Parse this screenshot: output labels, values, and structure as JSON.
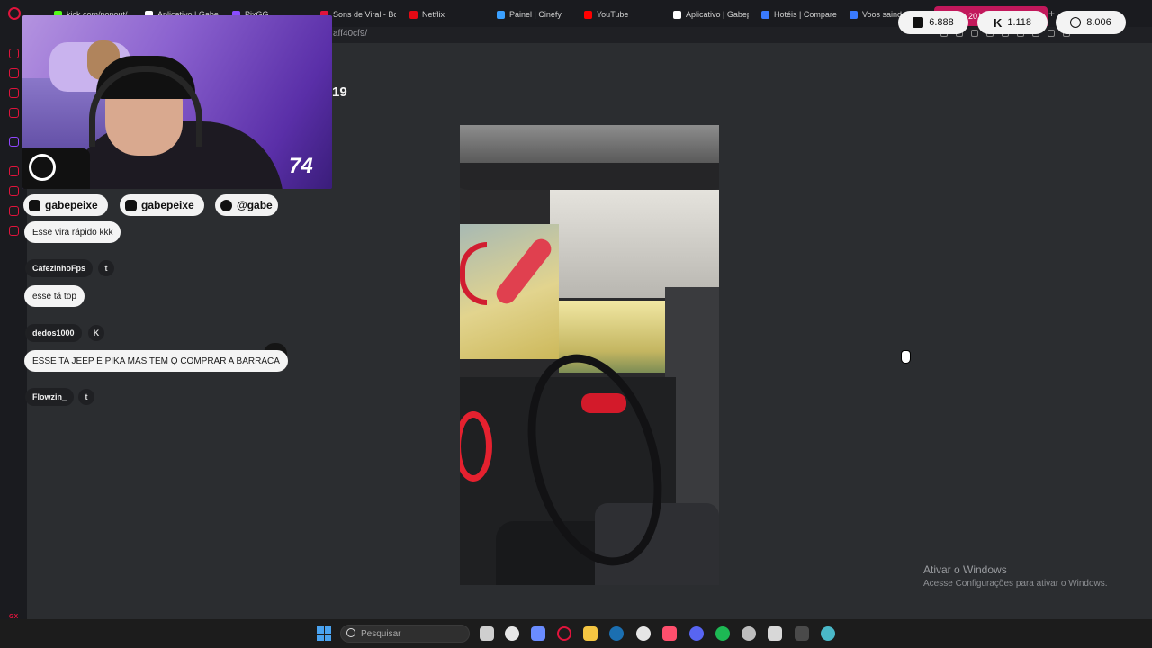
{
  "browser": {
    "tabs": [
      {
        "label": "kick.com/popout/",
        "color": "#53fc18"
      },
      {
        "label": "Aplicativo | Gabep",
        "color": "#ffffff"
      },
      {
        "label": "PixGG",
        "color": "#8a4dff"
      },
      {
        "label": "Sons de Viral - Bo",
        "color": "#e0143c"
      },
      {
        "label": "Netflix",
        "color": "#e50914"
      },
      {
        "label": "Painel | Cinefy",
        "color": "#3aa0ff"
      },
      {
        "label": "YouTube",
        "color": "#ff0000"
      },
      {
        "label": "Aplicativo | Gabep",
        "color": "#ffffff"
      },
      {
        "label": "Hotéis | Compare",
        "color": "#3a7bff"
      },
      {
        "label": "Voos saindo de",
        "color": "#3a7bff"
      }
    ],
    "active_tab": "Jeep 2019",
    "url": "aff40cf9/"
  },
  "page": {
    "heading": "19"
  },
  "webcam": {
    "overlay_number": "74"
  },
  "socials": [
    {
      "handle": "gabepeixe",
      "icon": "youtube-icon"
    },
    {
      "handle": "gabepeixe",
      "icon": "instagram-icon"
    },
    {
      "handle": "@gabe",
      "icon": "tiktok-icon"
    }
  ],
  "chat": {
    "first_message": "Esse vira rápido kkk",
    "entries": [
      {
        "user": "CafezinhoFps",
        "platform": "twitch",
        "badge": "t",
        "message": "esse tá top"
      },
      {
        "user": "dedos1000",
        "platform": "kick",
        "badge": "K",
        "message": "ESSE TA JEEP É PIKA MAS TEM Q COMPRAR A BARRACA"
      },
      {
        "user": "Flowzin_",
        "platform": "twitch",
        "badge": "t",
        "message": ""
      }
    ]
  },
  "viewers": {
    "twitch": "6.888",
    "kick": "1.118",
    "total": "8.006"
  },
  "watermark": {
    "title": "Ativar o Windows",
    "subtitle": "Acesse Configurações para ativar o Windows."
  },
  "taskbar": {
    "search_placeholder": "Pesquisar",
    "apps": [
      {
        "name": "file-icon",
        "color": "#cfcfcf"
      },
      {
        "name": "app-face-icon",
        "color": "#e6e6e6"
      },
      {
        "name": "copilot-icon",
        "color": "#6a8cff"
      },
      {
        "name": "opera-gx-icon",
        "color": "#e0143c"
      },
      {
        "name": "folder-icon",
        "color": "#f4c542"
      },
      {
        "name": "steam-icon",
        "color": "#1b6fb1"
      },
      {
        "name": "app-face2-icon",
        "color": "#e6e6e6"
      },
      {
        "name": "capcut-icon",
        "color": "#ff4f6d"
      },
      {
        "name": "discord-icon",
        "color": "#5865f2"
      },
      {
        "name": "spotify-icon",
        "color": "#1db954"
      },
      {
        "name": "obs-icon",
        "color": "#bdbdbd"
      },
      {
        "name": "capcut2-icon",
        "color": "#d8d8d8"
      },
      {
        "name": "terminal-icon",
        "color": "#4a4a4a"
      },
      {
        "name": "globe-app-icon",
        "color": "#4ab8c8"
      }
    ]
  }
}
